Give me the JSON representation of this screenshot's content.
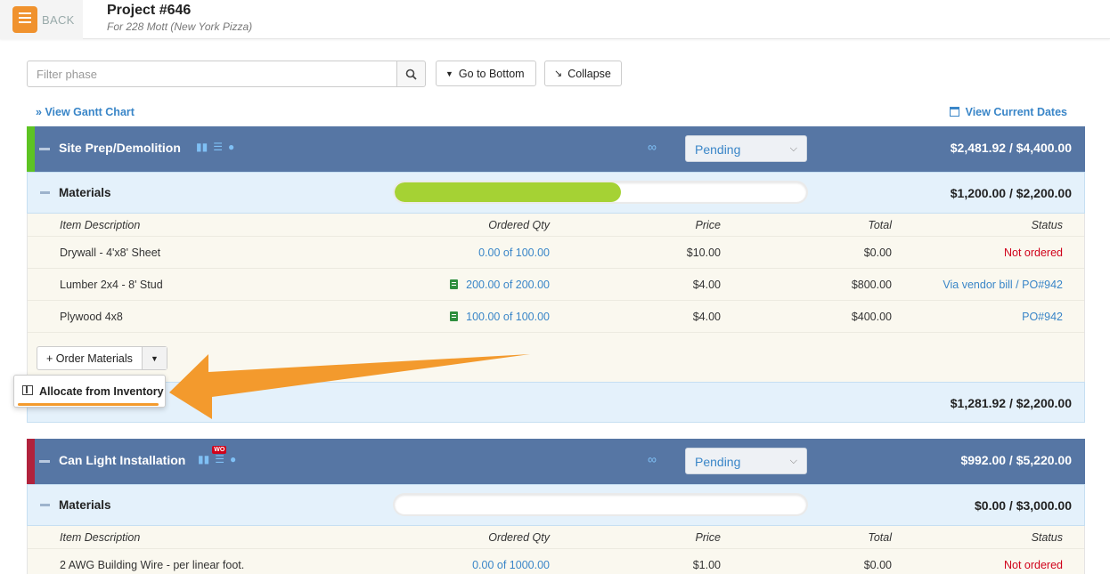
{
  "header": {
    "back_label": "BACK",
    "project_title": "Project #646",
    "project_subtitle": "For 228 Mott (New York Pizza)"
  },
  "toolbar": {
    "filter_placeholder": "Filter phase",
    "go_bottom_label": "Go to Bottom",
    "collapse_label": "Collapse",
    "gantt_link": "View Gantt Chart",
    "dates_link": "View Current Dates"
  },
  "colors": {
    "phase_header": "#5676a4",
    "accent_orange": "#f39a2d",
    "progress_green": "#a5d234",
    "link_blue": "#3a86c8"
  },
  "columns": {
    "desc": "Item Description",
    "qty": "Ordered Qty",
    "price": "Price",
    "total": "Total",
    "status": "Status"
  },
  "phases": [
    {
      "name": "Site Prep/Demolition",
      "strip_color": "#5dc323",
      "status": "Pending",
      "total": "$2,481.92 / $4,400.00",
      "materials": {
        "label": "Materials",
        "progress": 0.55,
        "total": "$1,200.00 / $2,200.00",
        "items": [
          {
            "desc": "Drywall - 4'x8' Sheet",
            "qty": "0.00 of 100.00",
            "price": "$10.00",
            "total": "$0.00",
            "status": "Not ordered"
          },
          {
            "desc": "Lumber 2x4 - 8' Stud",
            "qty": "200.00 of 200.00",
            "price": "$4.00",
            "total": "$800.00",
            "status": "Via vendor bill / PO#942"
          },
          {
            "desc": "Plywood 4x8",
            "qty": "100.00 of 100.00",
            "price": "$4.00",
            "total": "$400.00",
            "status": "PO#942"
          }
        ],
        "order_button": "+ Order Materials",
        "remaining_total": "$1,281.92 / $2,200.00"
      }
    },
    {
      "name": "Can Light Installation",
      "strip_color": "#b1223c",
      "badge": "WO",
      "status": "Pending",
      "total": "$992.00 / $5,220.00",
      "materials": {
        "label": "Materials",
        "progress": 0,
        "total": "$0.00 / $3,000.00",
        "items": [
          {
            "desc": "2 AWG Building Wire - per linear foot.",
            "qty": "0.00 of 1000.00",
            "price": "$1.00",
            "total": "$0.00",
            "status": "Not ordered"
          }
        ]
      }
    }
  ],
  "dropdown": {
    "allocate_label": "Allocate from Inventory"
  }
}
